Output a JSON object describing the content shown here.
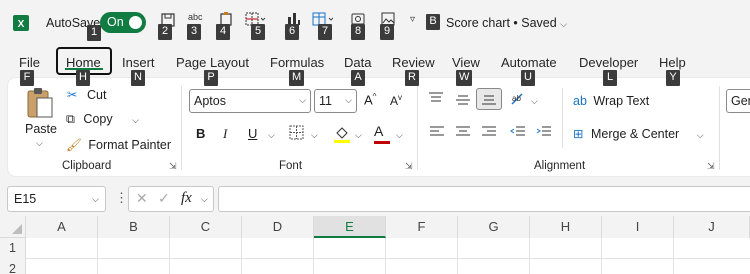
{
  "titlebar": {
    "autosave_label": "AutoSave",
    "autosave_state": "On",
    "doc_title": "Score chart",
    "saved_status": "Saved",
    "keytips": [
      "1",
      "2",
      "3",
      "4",
      "5",
      "6",
      "7",
      "8",
      "9"
    ],
    "title_keytip": "B"
  },
  "tabs": [
    {
      "label": "File",
      "keytip": "F"
    },
    {
      "label": "Home",
      "keytip": "H"
    },
    {
      "label": "Insert",
      "keytip": "N"
    },
    {
      "label": "Page Layout",
      "keytip": "P"
    },
    {
      "label": "Formulas",
      "keytip": "M"
    },
    {
      "label": "Data",
      "keytip": "A"
    },
    {
      "label": "Review",
      "keytip": "R"
    },
    {
      "label": "View",
      "keytip": "W"
    },
    {
      "label": "Automate",
      "keytip": "U"
    },
    {
      "label": "Developer",
      "keytip": "L"
    },
    {
      "label": "Help",
      "keytip": "Y"
    }
  ],
  "clipboard": {
    "paste": "Paste",
    "cut": "Cut",
    "copy": "Copy",
    "format_painter": "Format Painter",
    "label": "Clipboard"
  },
  "font": {
    "name": "Aptos",
    "size": "11",
    "bold": "B",
    "italic": "I",
    "underline": "U",
    "font_color": "A",
    "label": "Font"
  },
  "alignment": {
    "wrap_text": "Wrap Text",
    "merge_center": "Merge & Center",
    "label": "Alignment"
  },
  "number": {
    "format": "Gen"
  },
  "formula_bar": {
    "name_box": "E15",
    "fx": "fx"
  },
  "grid": {
    "columns": [
      "A",
      "B",
      "C",
      "D",
      "E",
      "F",
      "G",
      "H",
      "I",
      "J"
    ],
    "rows": [
      "1",
      "2"
    ]
  },
  "colors": {
    "accent": "#107c41",
    "highlight": "#ffff00",
    "font_color_bar": "#c00000",
    "keytip_bg": "#3b3b3b"
  }
}
